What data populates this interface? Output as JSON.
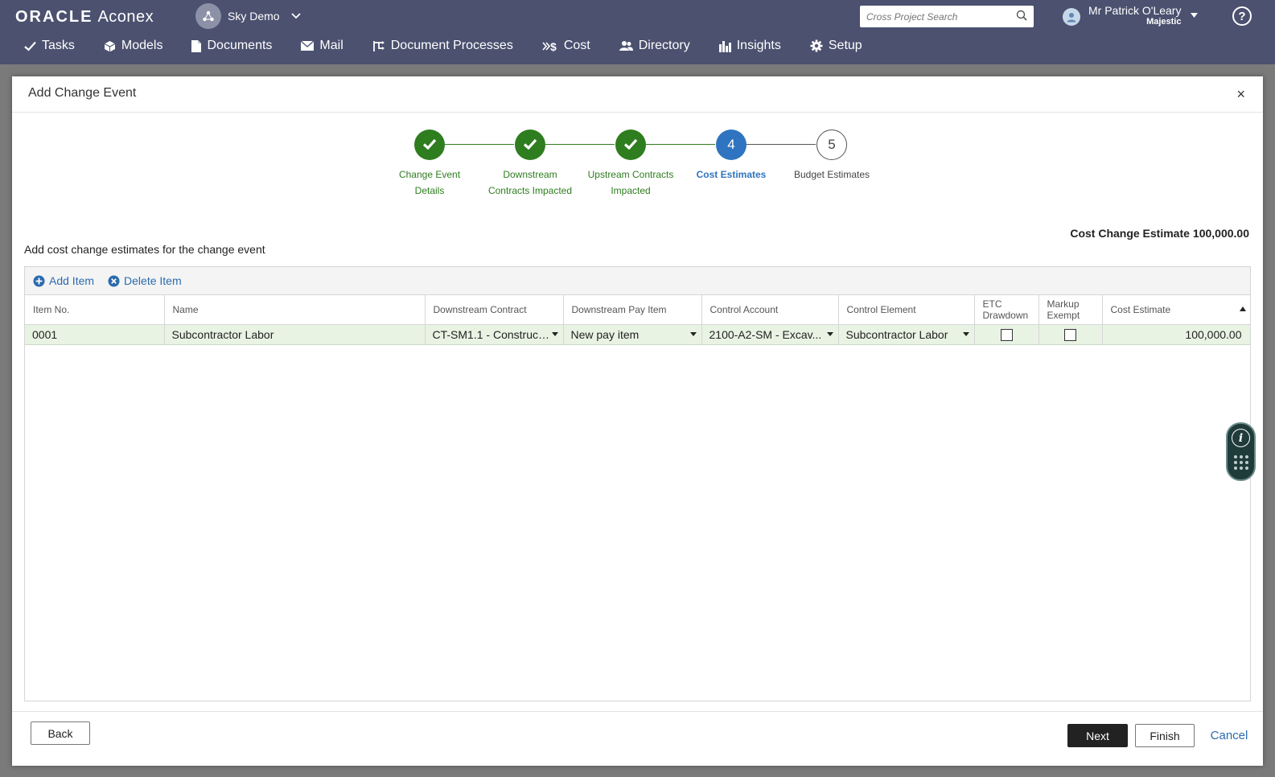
{
  "header": {
    "brand": "ORACLE",
    "product": "Aconex",
    "project_name": "Sky Demo",
    "search_placeholder": "Cross Project Search",
    "user_name": "Mr Patrick O'Leary",
    "user_org": "Majestic",
    "help_label": "?"
  },
  "nav": {
    "items": [
      {
        "label": "Tasks",
        "icon": "check-icon"
      },
      {
        "label": "Models",
        "icon": "cube-icon"
      },
      {
        "label": "Documents",
        "icon": "document-icon"
      },
      {
        "label": "Mail",
        "icon": "mail-icon"
      },
      {
        "label": "Document Processes",
        "icon": "workflow-icon"
      },
      {
        "label": "Cost",
        "icon": "cost-icon"
      },
      {
        "label": "Directory",
        "icon": "people-icon"
      },
      {
        "label": "Insights",
        "icon": "bar-chart-icon"
      },
      {
        "label": "Setup",
        "icon": "gear-icon"
      }
    ]
  },
  "modal": {
    "title": "Add Change Event",
    "close_label": "×",
    "steps": [
      {
        "number": "1",
        "line1": "Change Event",
        "line2": "Details",
        "state": "done"
      },
      {
        "number": "2",
        "line1": "Downstream",
        "line2": "Contracts Impacted",
        "state": "done"
      },
      {
        "number": "3",
        "line1": "Upstream Contracts",
        "line2": "Impacted",
        "state": "done"
      },
      {
        "number": "4",
        "line1": "Cost Estimates",
        "line2": "",
        "state": "active"
      },
      {
        "number": "5",
        "line1": "Budget Estimates",
        "line2": "",
        "state": "todo"
      }
    ],
    "estimate_label": "Cost Change Estimate",
    "estimate_value": "100,000.00",
    "instructions": "Add cost change estimates for the change event"
  },
  "grid": {
    "add_item": "Add Item",
    "delete_item": "Delete Item",
    "columns": {
      "item_no": "Item No.",
      "name": "Name",
      "downstream_contract": "Downstream Contract",
      "downstream_pay_item": "Downstream Pay Item",
      "control_account": "Control Account",
      "control_element": "Control Element",
      "etc_drawdown_1": "ETC",
      "etc_drawdown_2": "Drawdown",
      "markup_exempt_1": "Markup",
      "markup_exempt_2": "Exempt",
      "cost_estimate": "Cost Estimate"
    },
    "rows": [
      {
        "item_no": "0001",
        "name": "Subcontractor Labor",
        "downstream_contract": "CT-SM1.1 - Construct...",
        "downstream_pay_item": "New pay item",
        "control_account": "2100-A2-SM - Excav...",
        "control_element": "Subcontractor Labor",
        "etc_drawdown": false,
        "markup_exempt": false,
        "cost_estimate": "100,000.00"
      }
    ]
  },
  "footer": {
    "back": "Back",
    "next": "Next",
    "finish": "Finish",
    "cancel": "Cancel"
  },
  "colors": {
    "header_bg": "#4b516f",
    "step_done": "#2e7d1f",
    "step_active": "#2f74c0",
    "link": "#2b6bae",
    "row_bg": "#e9f3e4"
  }
}
